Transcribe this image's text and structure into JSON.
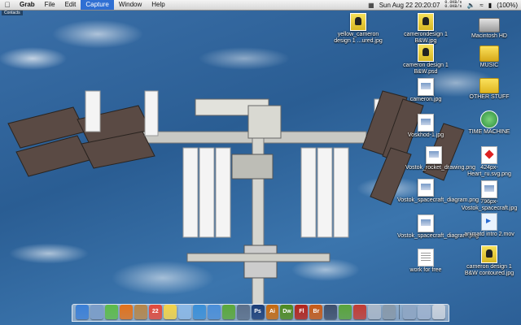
{
  "menubar": {
    "apple_icon": "apple-icon",
    "app_name": "Grab",
    "menus": [
      "File",
      "Edit",
      "Capture",
      "Window",
      "Help"
    ],
    "active_menu": "Capture",
    "net_up": "0.0KB/s",
    "net_down": "0.0KB/s",
    "battery": "(100%)",
    "datetime": "Sun Aug 22 20:20:07",
    "status_icons": [
      "calendar-icon",
      "volume-icon",
      "wifi-icon",
      "battery-icon"
    ]
  },
  "contacts_label": "Contacts",
  "desktop_icons": [
    {
      "name": "yellow_cameron design 1 ...ured.jpg",
      "kind": "img"
    },
    {
      "name": "camerondesign 1 B&W.jpg",
      "kind": "img"
    },
    {
      "name": "Macintosh HD",
      "kind": "hd"
    },
    {
      "name": "cameron design 1 B&W.psd",
      "kind": "psd"
    },
    {
      "name": "MUSIC",
      "kind": "music"
    },
    {
      "name": "cameron.jpg",
      "kind": "doc"
    },
    {
      "name": "OTHER STUFF",
      "kind": "folder"
    },
    {
      "name": "Voskhod-1.jpg",
      "kind": "doc"
    },
    {
      "name": "TIME MACHINE",
      "kind": "tm"
    },
    {
      "name": "Vostok_rocket_drawing.png",
      "kind": "doc"
    },
    {
      "name": "424px-Heart_ru.svg.png",
      "kind": "svg"
    },
    {
      "name": "Vostok_spacecraft_diagram.png",
      "kind": "doc"
    },
    {
      "name": "796px-Vostok_spacecraft.jpg",
      "kind": "doc"
    },
    {
      "name": "Vostok_spacecraft_diagram.png",
      "kind": "doc"
    },
    {
      "name": "animatd intro 2.mov",
      "kind": "mov"
    },
    {
      "name": "work for free",
      "kind": "txt"
    },
    {
      "name": "cameron design 1 B&W contoured.jpg",
      "kind": "img"
    }
  ],
  "dock": {
    "items": [
      {
        "icon": "finder-icon",
        "color": "#3b7fd6",
        "label": ""
      },
      {
        "icon": "mail-icon",
        "color": "#7a9cc8",
        "label": ""
      },
      {
        "icon": "ichat-icon",
        "color": "#5dbb4a",
        "label": ""
      },
      {
        "icon": "firefox-icon",
        "color": "#e1721c",
        "label": ""
      },
      {
        "icon": "addressbook-icon",
        "color": "#b5864b",
        "label": ""
      },
      {
        "icon": "ical-icon",
        "color": "#e34a3c",
        "label": "22"
      },
      {
        "icon": "stickies-icon",
        "color": "#f2d34a",
        "label": ""
      },
      {
        "icon": "preview-icon",
        "color": "#8bb8e6",
        "label": ""
      },
      {
        "icon": "clock-icon",
        "color": "#3a8fd8",
        "label": ""
      },
      {
        "icon": "itunes-icon",
        "color": "#4a8ed8",
        "label": ""
      },
      {
        "icon": "spotify-icon",
        "color": "#5aa83a",
        "label": ""
      },
      {
        "icon": "stack-icon",
        "color": "#5b6f8a",
        "label": ""
      },
      {
        "icon": "photoshop-icon",
        "color": "#1b3e78",
        "label": "Ps"
      },
      {
        "icon": "illustrator-icon",
        "color": "#c66a10",
        "label": "Ai"
      },
      {
        "icon": "dreamweaver-icon",
        "color": "#4e8a1f",
        "label": "Dw"
      },
      {
        "icon": "flash-icon",
        "color": "#b3241b",
        "label": "Fl"
      },
      {
        "icon": "bridge-icon",
        "color": "#c65a17",
        "label": "Br"
      },
      {
        "icon": "iphoto-icon",
        "color": "#3d4f6c",
        "label": ""
      },
      {
        "icon": "utorrent-icon",
        "color": "#59a33b",
        "label": ""
      },
      {
        "icon": "toolbox-icon",
        "color": "#c13b34",
        "label": ""
      },
      {
        "icon": "preview2-icon",
        "color": "#a9b7c8",
        "label": ""
      },
      {
        "icon": "grab-icon",
        "color": "#8899aa",
        "label": ""
      },
      {
        "icon": "applications-stack-icon",
        "color": "#8fa6c4",
        "label": ""
      },
      {
        "icon": "documents-stack-icon",
        "color": "#9fb3cf",
        "label": ""
      },
      {
        "icon": "trash-icon",
        "color": "#c9d2dd",
        "label": ""
      }
    ]
  }
}
